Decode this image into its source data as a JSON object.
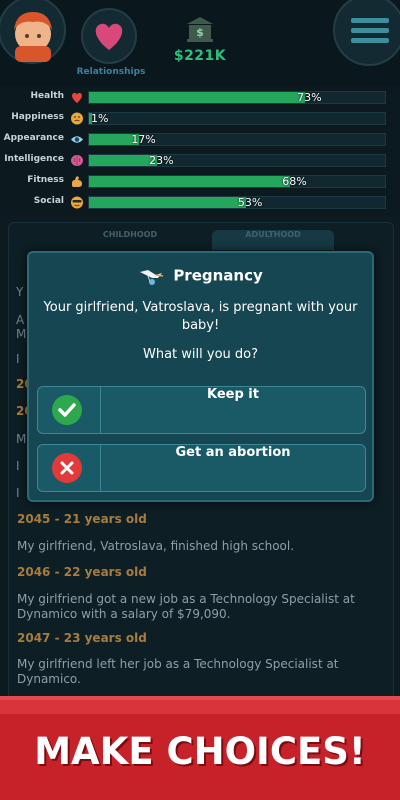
{
  "header": {
    "relationships_label": "Relationships",
    "money": "$221K"
  },
  "stats": [
    {
      "label": "Health",
      "value": "73%",
      "fill": 0.73,
      "icon": "heart-icon",
      "icon_color": "#e5453e"
    },
    {
      "label": "Happiness",
      "value": "1%",
      "fill": 0.01,
      "icon": "smiley-icon",
      "icon_color": "#e8a93a"
    },
    {
      "label": "Appearance",
      "value": "17%",
      "fill": 0.17,
      "icon": "eye-icon",
      "icon_color": "#9fd3ec"
    },
    {
      "label": "Intelligence",
      "value": "23%",
      "fill": 0.23,
      "icon": "brain-icon",
      "icon_color": "#d55c93"
    },
    {
      "label": "Fitness",
      "value": "68%",
      "fill": 0.68,
      "icon": "flexed-arm-icon",
      "icon_color": "#e9a64a"
    },
    {
      "label": "Social",
      "value": "53%",
      "fill": 0.53,
      "icon": "sunglasses-smiley-icon",
      "icon_color": "#e8a93a"
    }
  ],
  "tabs": {
    "childhood": "CHILDHOOD",
    "adulthood": "ADULTHOOD"
  },
  "log_hidden_fragments": [
    "Y",
    "A",
    "M",
    "I",
    "20",
    "20",
    "M",
    "I",
    "I"
  ],
  "log": [
    {
      "year": "2045 - 21 years old",
      "text": "My girlfriend, Vatroslava, finished high school."
    },
    {
      "year": "2046 - 22 years old",
      "text": "My girlfriend got a new job as a Technology Specialist at Dynamico with a salary of $79,090."
    },
    {
      "year": "2047 - 23 years old",
      "text": "My girlfriend left her job as a Technology Specialist at Dynamico."
    }
  ],
  "modal": {
    "title": "Pregnancy",
    "message": "Your girlfriend, Vatroslava, is pregnant with your baby!",
    "question": "What will you do?",
    "choices": [
      {
        "label": "Keep it",
        "icon": "checkmark-icon",
        "color": "#2ea84c"
      },
      {
        "label": "Get an abortion",
        "icon": "x-icon",
        "color": "#e03a3a"
      }
    ]
  },
  "banner": {
    "text": "MAKE CHOICES!"
  },
  "colors": {
    "bar_fill": "#25a65d",
    "money": "#2cc07a",
    "year_label": "#a67c40",
    "banner": "#c7212a"
  }
}
